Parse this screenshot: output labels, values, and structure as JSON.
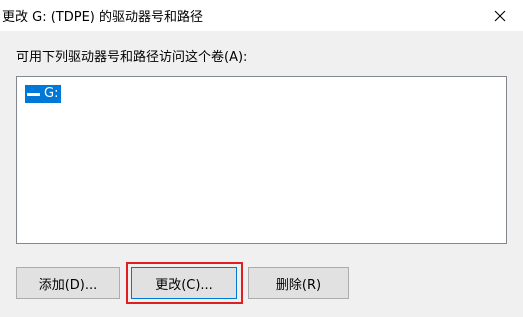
{
  "window": {
    "title": "更改 G: (TDPE) 的驱动器号和路径"
  },
  "prompt": "可用下列驱动器号和路径访问这个卷(A):",
  "list": {
    "items": [
      {
        "label": "G:",
        "icon": "drive-icon",
        "selected": true
      }
    ]
  },
  "buttons": {
    "add": "添加(D)...",
    "change": "更改(C)...",
    "delete": "删除(R)"
  },
  "colors": {
    "selection": "#0078d7",
    "highlight": "#e02020"
  },
  "icons": {
    "close": "close-icon"
  }
}
